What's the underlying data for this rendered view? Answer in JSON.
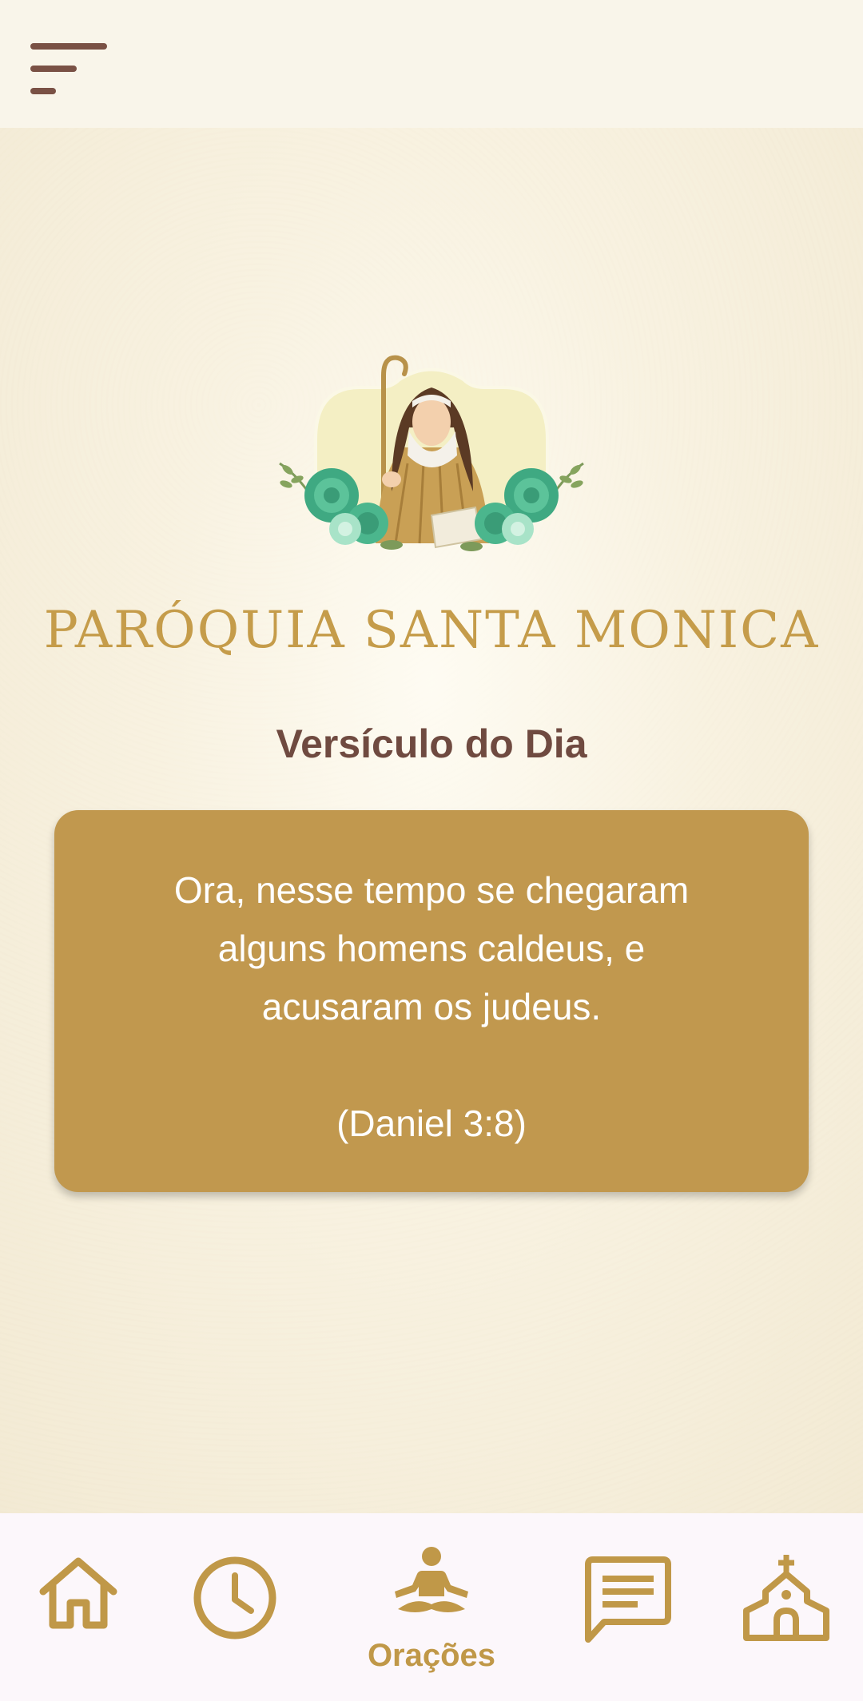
{
  "header": {
    "menu_icon": "menu-icon"
  },
  "logo": {
    "icon": "saint-monica-logo"
  },
  "parish": {
    "title": "PARÓQUIA SANTA MONICA"
  },
  "verse": {
    "heading": "Versículo do Dia",
    "line1": "Ora, nesse tempo se chegaram",
    "line2": "alguns homens caldeus, e",
    "line3": "acusaram os judeus.",
    "reference": "(Daniel 3:8)"
  },
  "bottom_nav": {
    "items": [
      {
        "icon": "home-icon",
        "label": ""
      },
      {
        "icon": "clock-icon",
        "label": ""
      },
      {
        "icon": "meditation-icon",
        "label": "Orações",
        "active": true
      },
      {
        "icon": "message-icon",
        "label": ""
      },
      {
        "icon": "church-icon",
        "label": ""
      }
    ]
  },
  "colors": {
    "accent": "#c1984e",
    "heading": "#6f4a40",
    "title_gold": "#c59c4a",
    "background": "#f7f1e2",
    "nav_background": "#fcf7fb"
  }
}
